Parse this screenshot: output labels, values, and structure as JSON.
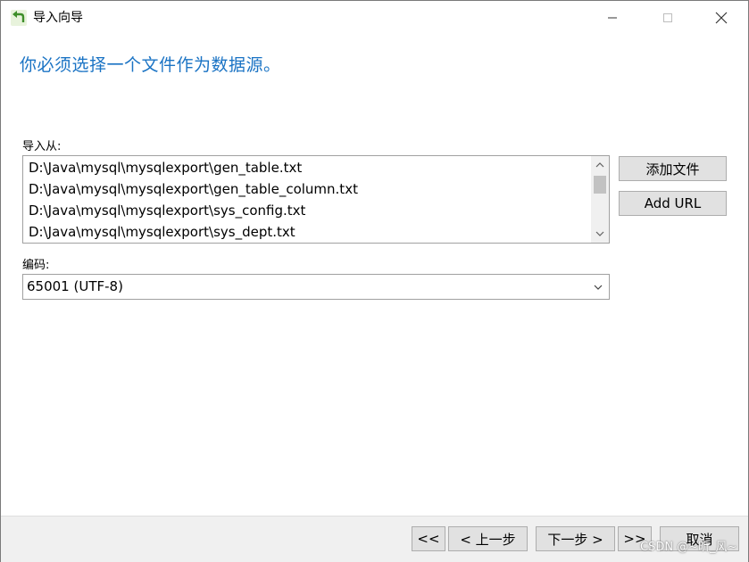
{
  "window": {
    "title": "导入向导",
    "minimize_label": "Minimize",
    "maximize_label": "Maximize",
    "close_label": "Close"
  },
  "heading": "你必须选择一个文件作为数据源。",
  "import_from": {
    "label": "导入从:",
    "files": [
      "D:\\Java\\mysql\\mysqlexport\\gen_table.txt",
      "D:\\Java\\mysql\\mysqlexport\\gen_table_column.txt",
      "D:\\Java\\mysql\\mysqlexport\\sys_config.txt",
      "D:\\Java\\mysql\\mysqlexport\\sys_dept.txt"
    ]
  },
  "buttons": {
    "add_file": "添加文件",
    "add_url": "Add URL"
  },
  "encoding": {
    "label": "编码:",
    "value": "65001 (UTF-8)"
  },
  "nav": {
    "first": "<<",
    "prev": "< 上一步",
    "next": "下一步 >",
    "last": ">>",
    "cancel": "取消"
  },
  "watermark": "CSDN @~昕_风~",
  "colors": {
    "heading": "#1a73c4",
    "button_bg": "#e1e1e1",
    "bottom_bar": "#f0f0f0"
  },
  "icons": {
    "app": "import-wizard-icon",
    "scroll_up": "chevron-up-icon",
    "scroll_down": "chevron-down-icon",
    "combo": "chevron-down-icon"
  }
}
